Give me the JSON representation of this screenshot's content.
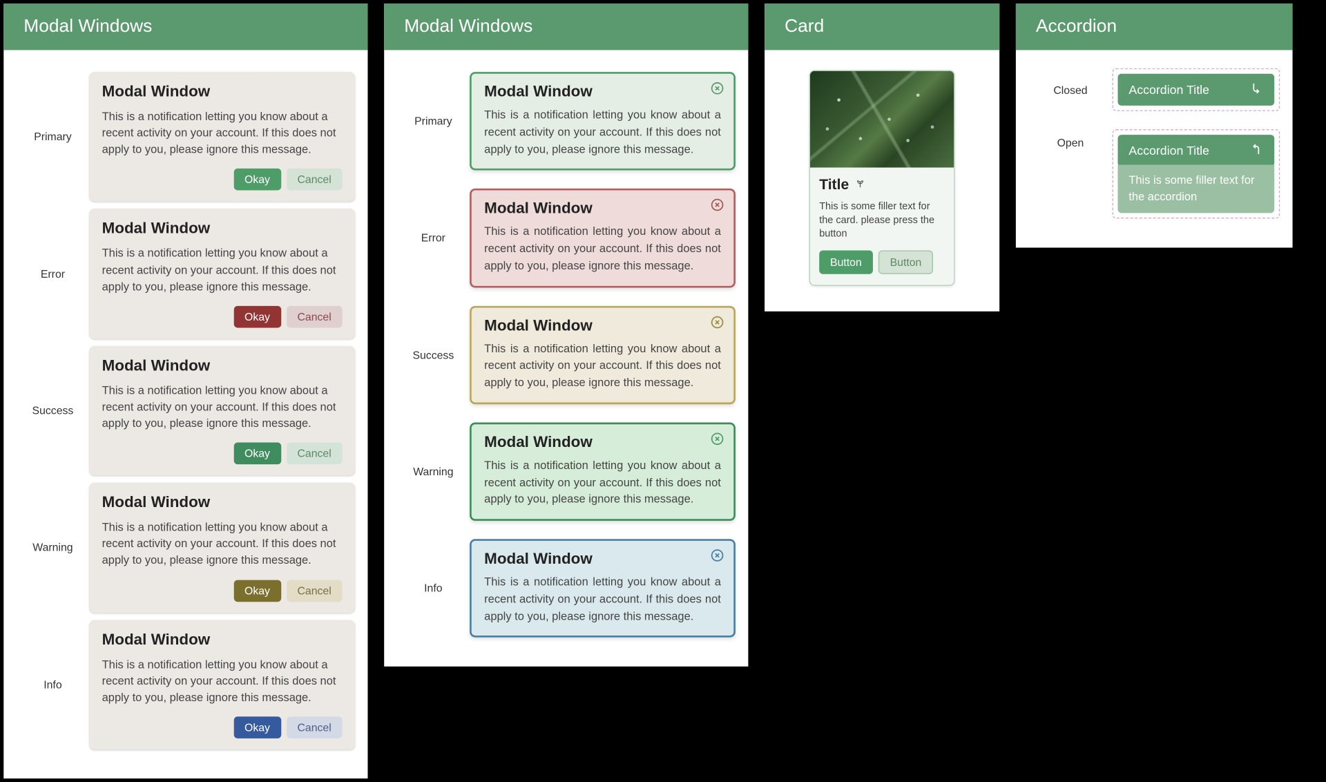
{
  "panel1": {
    "title": "Modal Windows",
    "variants": [
      "Primary",
      "Error",
      "Success",
      "Warning",
      "Info"
    ],
    "modal": {
      "heading": "Modal Window",
      "body": "This is a notification letting you know about a recent activity on your account. If this does not apply to you, please ignore this message.",
      "ok": "Okay",
      "cancel": "Cancel"
    }
  },
  "panel2": {
    "title": "Modal Windows",
    "variants": [
      "Primary",
      "Error",
      "Success",
      "Warning",
      "Info"
    ],
    "modal": {
      "heading": "Modal Window",
      "body": "This is a notification letting you know about a recent activity on your account. If this does not apply to you, please ignore this message."
    }
  },
  "panel3": {
    "title": "Card",
    "card": {
      "title": "Title",
      "text": "This is some filler text for the card. please press the button",
      "btnA": "Button",
      "btnB": "Button"
    }
  },
  "panel4": {
    "title": "Accordion",
    "labels": {
      "closed": "Closed",
      "open": "Open"
    },
    "item": {
      "title": "Accordion Title",
      "body": "This is some filler text for the accordion"
    }
  }
}
